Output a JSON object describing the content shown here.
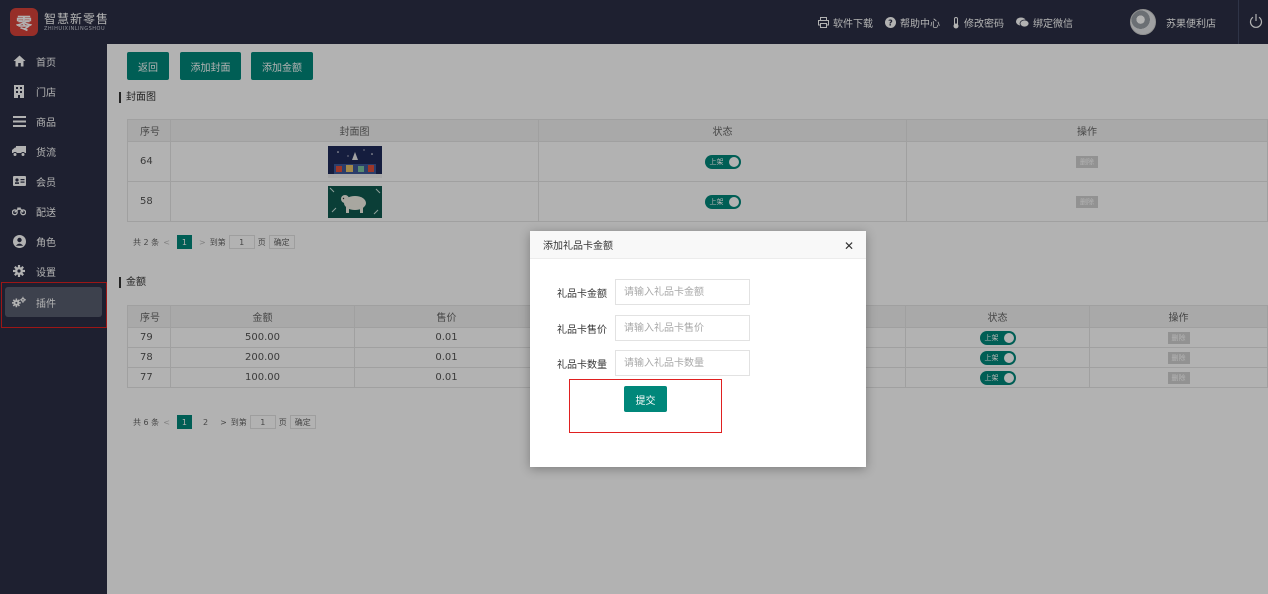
{
  "brand": {
    "name_cn": "智慧新零售",
    "name_en": "ZHIHUIXINLINGSHOU",
    "mark": "零"
  },
  "header": {
    "links": [
      {
        "label": "软件下载",
        "icon": "printer-icon"
      },
      {
        "label": "帮助中心",
        "icon": "help-icon"
      },
      {
        "label": "修改密码",
        "icon": "thermometer-icon"
      },
      {
        "label": "绑定微信",
        "icon": "wechat-icon"
      }
    ],
    "user_name": "苏果便利店"
  },
  "sidebar": {
    "items": [
      {
        "label": "首页",
        "icon": "home-icon"
      },
      {
        "label": "门店",
        "icon": "building-icon"
      },
      {
        "label": "商品",
        "icon": "menu-icon"
      },
      {
        "label": "货流",
        "icon": "truck-icon"
      },
      {
        "label": "会员",
        "icon": "id-card-icon"
      },
      {
        "label": "配送",
        "icon": "motorcycle-icon"
      },
      {
        "label": "角色",
        "icon": "user-circle-icon"
      },
      {
        "label": "设置",
        "icon": "gear-icon"
      },
      {
        "label": "插件",
        "icon": "gears-icon",
        "active": true
      }
    ]
  },
  "toolbar": {
    "back_label": "返回",
    "add_cover_label": "添加封面",
    "add_amount_label": "添加金额"
  },
  "cover_section": {
    "title": "封面图",
    "columns": [
      "序号",
      "封面图",
      "状态",
      "操作"
    ],
    "rows": [
      {
        "id": "64",
        "status": "上架",
        "action": "删除"
      },
      {
        "id": "58",
        "status": "上架",
        "action": "删除"
      }
    ],
    "pager": {
      "total": "共 2 条",
      "pages": [
        "1"
      ],
      "goto_label": "到第",
      "goto_value": "1",
      "page_label": "页",
      "confirm": "确定"
    }
  },
  "amount_section": {
    "title": "金额",
    "columns": [
      "序号",
      "金额",
      "售价",
      "状态",
      "操作"
    ],
    "rows": [
      {
        "id": "79",
        "amount": "500.00",
        "price": "0.01",
        "status": "上架",
        "action": "删除"
      },
      {
        "id": "78",
        "amount": "200.00",
        "price": "0.01",
        "status": "上架",
        "action": "删除"
      },
      {
        "id": "77",
        "amount": "100.00",
        "price": "0.01",
        "status": "上架",
        "action": "删除"
      }
    ],
    "pager": {
      "total": "共 6 条",
      "pages": [
        "1",
        "2"
      ],
      "goto_label": "到第",
      "goto_value": "1",
      "page_label": "页",
      "confirm": "确定"
    }
  },
  "modal": {
    "title": "添加礼品卡金额",
    "fields": [
      {
        "label": "礼品卡金额",
        "placeholder": "请输入礼品卡金额"
      },
      {
        "label": "礼品卡售价",
        "placeholder": "请输入礼品卡售价"
      },
      {
        "label": "礼品卡数量",
        "placeholder": "请输入礼品卡数量"
      }
    ],
    "submit_label": "提交"
  },
  "colors": {
    "accent": "#00877a",
    "sidebar_bg": "#2b2f45",
    "highlight": "#e02020"
  }
}
